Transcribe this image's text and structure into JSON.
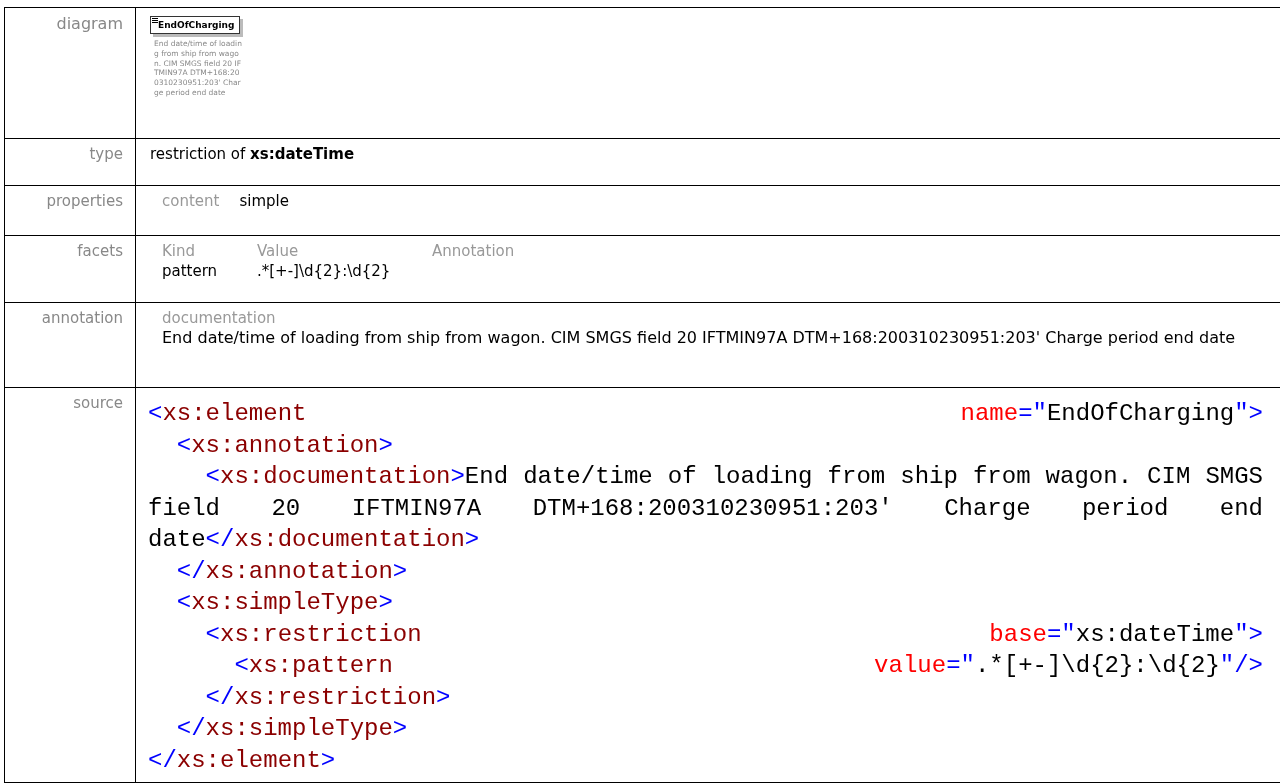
{
  "rows": [
    {
      "kind": "diagram",
      "label": "diagram",
      "element": {
        "name": "EndOfCharging",
        "doc": "End date/time of loading from ship from wagon. CIM SMGS field 20 IFTMIN97A DTM+168:200310230951:203' Charge period end date"
      }
    },
    {
      "kind": "text",
      "label": "type",
      "text": "restriction of **xs:dateTime**"
    },
    {
      "kind": "pairs",
      "label": "properties",
      "pairs": [
        {
          "key": "content",
          "value": "simple"
        }
      ]
    },
    {
      "kind": "facets",
      "label": "facets",
      "columns": [
        "Kind",
        "Value",
        "Annotation"
      ],
      "facets": [
        {
          "kind": "pattern",
          "value": ".*[+-]\\d{2}:\\d{2}"
        }
      ]
    },
    {
      "kind": "annotation",
      "label": "annotation",
      "heading": "documentation",
      "text": "End date/time of loading from ship from wagon. CIM SMGS field 20 IFTMIN97A DTM+168:200310230951:203' Charge period end date"
    },
    {
      "kind": "source",
      "label": "source",
      "tree": [
        {
          "open": [
            {
              "kind": "punct",
              "text": "<"
            },
            {
              "kind": "tag",
              "text": "xs:element "
            },
            {
              "kind": "attr",
              "text": "name"
            },
            {
              "kind": "punct",
              "text": "=\""
            },
            {
              "kind": "value",
              "text": "EndOfCharging"
            },
            {
              "kind": "punct",
              "text": "\">"
            }
          ],
          "close": [
            {
              "kind": "punct",
              "text": "</"
            },
            {
              "kind": "tag",
              "text": "xs:element"
            },
            {
              "kind": "punct",
              "text": ">"
            }
          ],
          "children": [
            {
              "open": [
                {
                  "kind": "punct",
                  "text": "<"
                },
                {
                  "kind": "tag",
                  "text": "xs:annotation"
                },
                {
                  "kind": "punct",
                  "text": ">"
                }
              ],
              "close": [
                {
                  "kind": "punct",
                  "text": "</"
                },
                {
                  "kind": "tag",
                  "text": "xs:annotation"
                },
                {
                  "kind": "punct",
                  "text": ">"
                }
              ],
              "children": [
                {
                  "open": [
                    {
                      "kind": "punct",
                      "text": "<"
                    },
                    {
                      "kind": "tag",
                      "text": "xs:documentation"
                    },
                    {
                      "kind": "punct",
                      "text": ">"
                    },
                    {
                      "kind": "value",
                      "text": "End date/time of loading from ship from wagon. CIM SMGS field 20 IFTMIN97A DTM+168:200310230951:203' Charge period end date"
                    },
                    {
                      "kind": "punct",
                      "text": "</"
                    },
                    {
                      "kind": "tag",
                      "text": "xs:documentation"
                    },
                    {
                      "kind": "punct",
                      "text": ">"
                    }
                  ]
                }
              ]
            },
            {
              "open": [
                {
                  "kind": "punct",
                  "text": "<"
                },
                {
                  "kind": "tag",
                  "text": "xs:simpleType"
                },
                {
                  "kind": "punct",
                  "text": ">"
                }
              ],
              "close": [
                {
                  "kind": "punct",
                  "text": "</"
                },
                {
                  "kind": "tag",
                  "text": "xs:simpleType"
                },
                {
                  "kind": "punct",
                  "text": ">"
                }
              ],
              "children": [
                {
                  "open": [
                    {
                      "kind": "punct",
                      "text": "<"
                    },
                    {
                      "kind": "tag",
                      "text": "xs:restriction "
                    },
                    {
                      "kind": "attr",
                      "text": "base"
                    },
                    {
                      "kind": "punct",
                      "text": "=\""
                    },
                    {
                      "kind": "value",
                      "text": "xs:dateTime"
                    },
                    {
                      "kind": "punct",
                      "text": "\">"
                    }
                  ],
                  "close": [
                    {
                      "kind": "punct",
                      "text": "</"
                    },
                    {
                      "kind": "tag",
                      "text": "xs:restriction"
                    },
                    {
                      "kind": "punct",
                      "text": ">"
                    }
                  ],
                  "children": [
                    {
                      "open": [
                        {
                          "kind": "punct",
                          "text": "<"
                        },
                        {
                          "kind": "tag",
                          "text": "xs:pattern "
                        },
                        {
                          "kind": "attr",
                          "text": "value"
                        },
                        {
                          "kind": "punct",
                          "text": "=\""
                        },
                        {
                          "kind": "value",
                          "text": ".*[+-]\\d{2}:\\d{2}"
                        },
                        {
                          "kind": "punct",
                          "text": "\"/>"
                        }
                      ]
                    }
                  ]
                }
              ]
            }
          ]
        }
      ]
    }
  ]
}
